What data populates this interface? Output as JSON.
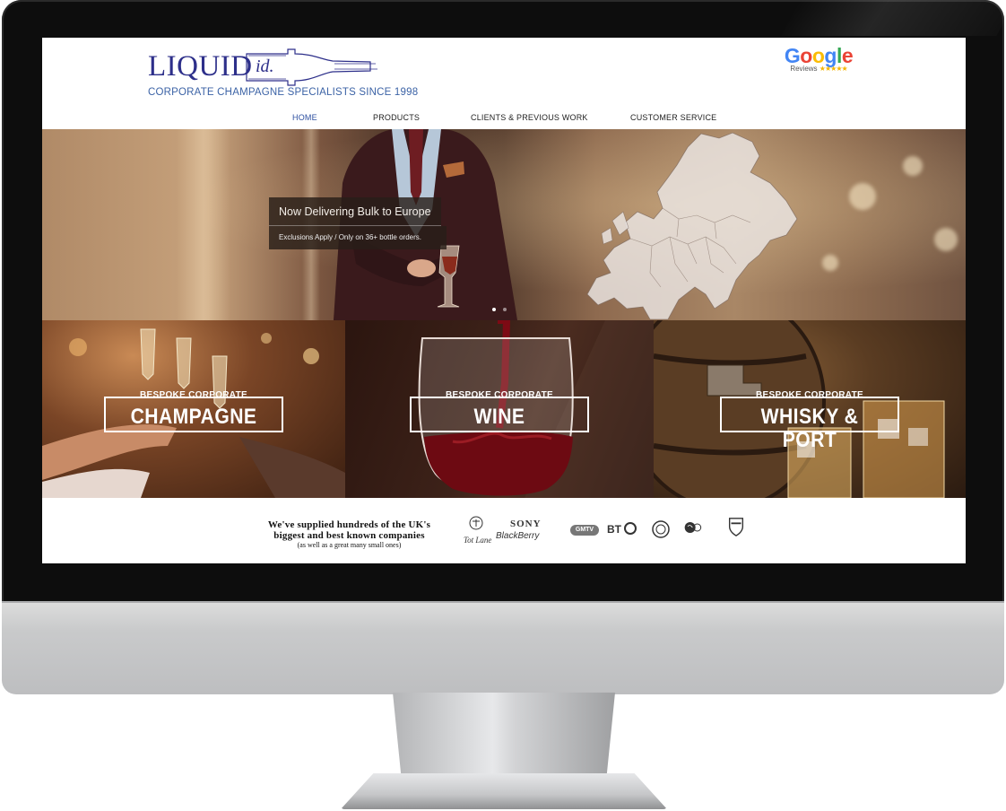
{
  "site": {
    "logo_main": "LIQUID",
    "logo_id": "id.",
    "tagline": "CORPORATE CHAMPAGNE SPECIALISTS SINCE 1998",
    "google": {
      "word": "Google",
      "reviews": "Reviews",
      "stars": "★★★★★"
    }
  },
  "nav": {
    "items": [
      {
        "label": "HOME"
      },
      {
        "label": "PRODUCTS"
      },
      {
        "label": "CLIENTS & PREVIOUS WORK"
      },
      {
        "label": "CUSTOMER SERVICE"
      }
    ],
    "active_index": 0
  },
  "hero": {
    "title": "Now Delivering Bulk to Europe",
    "subtitle": "Exclusions Apply / Only on 36+ bottle orders.",
    "slide_count": 3,
    "active_slide": 1
  },
  "tiles": [
    {
      "kicker": "BESPOKE CORPORATE",
      "name": "CHAMPAGNE"
    },
    {
      "kicker": "BESPOKE CORPORATE",
      "name": "WINE"
    },
    {
      "kicker": "BESPOKE CORPORATE",
      "name": "WHISKY & PORT"
    }
  ],
  "clients": {
    "line1": "We've supplied hundreds of the UK's",
    "line2": "biggest and best known companies",
    "line3": "(as well as a great many small ones)",
    "logos": {
      "script": "Tot Lane",
      "sony": "SONY",
      "blackberry": "BlackBerry",
      "gmtv": "GMTV",
      "bt": "BT"
    }
  },
  "colors": {
    "brand": "#2d2f8a",
    "tagline": "#3c63a6",
    "nav_active": "#2d4fa0"
  }
}
